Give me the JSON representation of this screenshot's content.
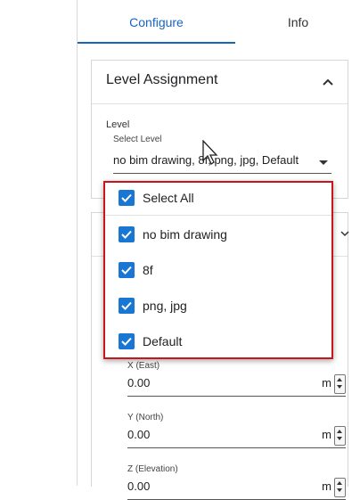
{
  "tabs": [
    {
      "label": "Configure",
      "active": true
    },
    {
      "label": "Info",
      "active": false
    }
  ],
  "level_card": {
    "title": "Level Assignment",
    "field_label": "Level",
    "select_label": "Select Level",
    "select_value": "no bim drawing, 8f, png, jpg, Default",
    "collapse_icon": "chevron-up-icon"
  },
  "dropdown": {
    "options": [
      {
        "label": "Select All",
        "checked": true
      },
      {
        "label": "no bim drawing",
        "checked": true
      },
      {
        "label": "8f",
        "checked": true
      },
      {
        "label": "png, jpg",
        "checked": true
      },
      {
        "label": "Default",
        "checked": true
      }
    ]
  },
  "position_card": {
    "fields": [
      {
        "label": "X (East)",
        "value": "0.00",
        "unit": "m"
      },
      {
        "label": "Y (North)",
        "value": "0.00",
        "unit": "m"
      },
      {
        "label": "Z (Elevation)",
        "value": "0.00",
        "unit": "m"
      }
    ]
  },
  "colors": {
    "accent": "#1565c0",
    "checkbox": "#1976d2",
    "highlight_border": "#c8161d"
  }
}
